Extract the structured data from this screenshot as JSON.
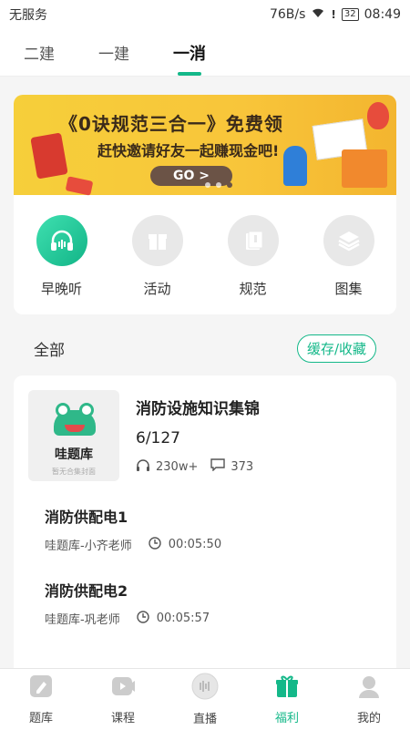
{
  "status_bar": {
    "carrier": "无服务",
    "network_speed": "76B/s",
    "battery": "32",
    "time": "08:49"
  },
  "top_tabs": [
    {
      "label": "二建",
      "active": false
    },
    {
      "label": "一建",
      "active": false
    },
    {
      "label": "一消",
      "active": true
    }
  ],
  "banner": {
    "title": "《0诀规范三合一》免费领",
    "subtitle": "赶快邀请好友一起赚现金吧!",
    "button": "GO >"
  },
  "quick_actions": [
    {
      "label": "早晚听",
      "icon": "headphones-icon"
    },
    {
      "label": "活动",
      "icon": "gift-icon"
    },
    {
      "label": "规范",
      "icon": "document-icon"
    },
    {
      "label": "图集",
      "icon": "layers-icon"
    }
  ],
  "section": {
    "title": "全部",
    "cache_button": "缓存/收藏"
  },
  "album": {
    "cover_title": "哇题库",
    "cover_note": "暂无合集封面",
    "name": "消防设施知识集锦",
    "progress": "6/127",
    "listens": "230w+",
    "comments": "373"
  },
  "episodes": [
    {
      "title": "消防供配电1",
      "author": "哇题库-小齐老师",
      "duration": "00:05:50"
    },
    {
      "title": "消防供配电2",
      "author": "哇题库-巩老师",
      "duration": "00:05:57"
    }
  ],
  "bottom_nav": [
    {
      "label": "题库",
      "icon": "pencil-icon",
      "active": false
    },
    {
      "label": "课程",
      "icon": "video-icon",
      "active": false
    },
    {
      "label": "直播",
      "icon": "live-icon",
      "active": false
    },
    {
      "label": "福利",
      "icon": "gift-icon",
      "active": true
    },
    {
      "label": "我的",
      "icon": "user-icon",
      "active": false
    }
  ],
  "colors": {
    "accent": "#14b889",
    "banner_yellow": "#f6cf3a"
  }
}
